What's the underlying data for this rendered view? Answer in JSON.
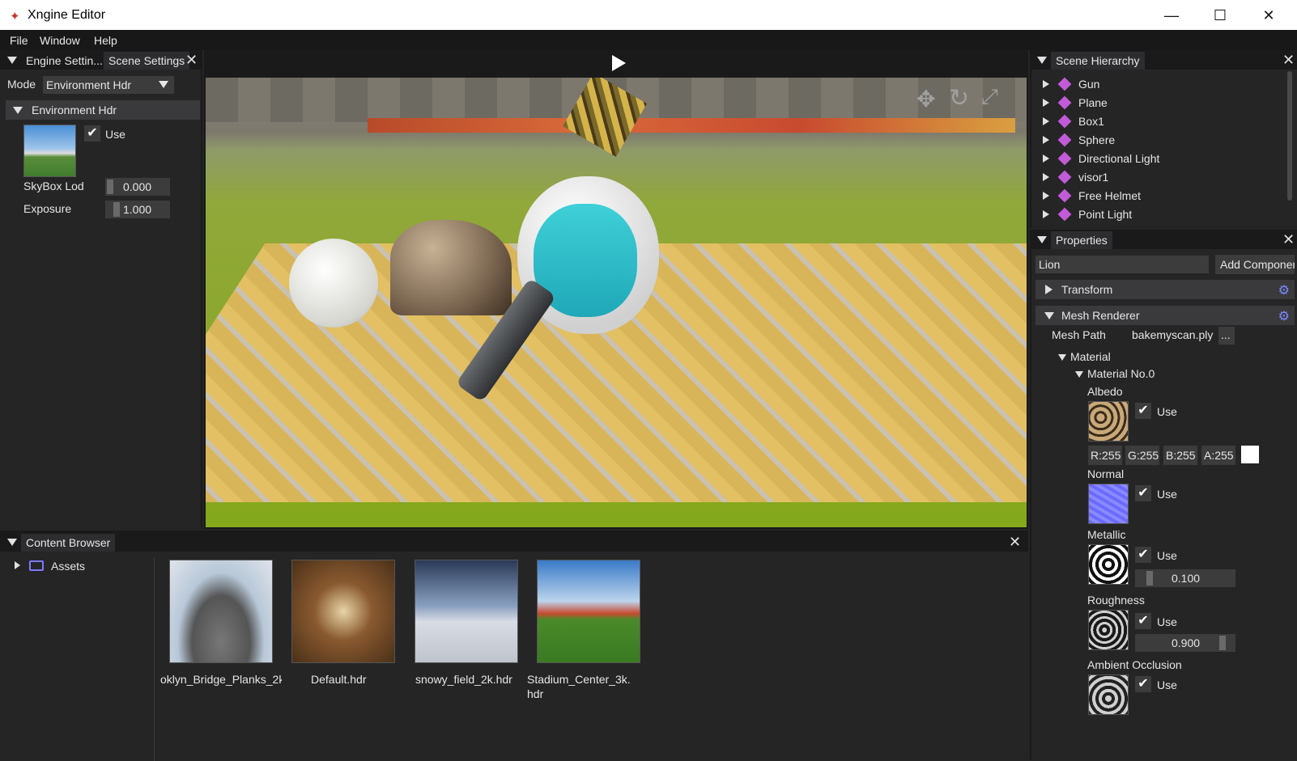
{
  "window": {
    "title": "Xngine Editor",
    "min_icon": "minimize-icon",
    "max_icon": "maximize-icon",
    "close_icon": "close-icon"
  },
  "menu": [
    "File",
    "Window",
    "Help"
  ],
  "engine_panel": {
    "tabs": [
      "Engine Settin...",
      "Scene Settings"
    ],
    "mode_label": "Mode",
    "mode_value": "Environment Hdr",
    "section": "Environment Hdr",
    "use_label": "Use",
    "skybox_label": "SkyBox Lod",
    "skybox_value": "0.000",
    "exposure_label": "Exposure",
    "exposure_value": "1.000"
  },
  "viewport": {
    "play_icon": "play-icon",
    "gizmo_icons": [
      "move-icon",
      "rotate-icon",
      "scale-icon"
    ]
  },
  "hierarchy": {
    "title": "Scene Hierarchy",
    "items": [
      "Gun",
      "Plane",
      "Box1",
      "Sphere",
      "Directional Light",
      "visor1",
      "Free Helmet",
      "Point Light"
    ]
  },
  "properties": {
    "title": "Properties",
    "name_value": "Lion",
    "add_component": "Add Componer",
    "transform": "Transform",
    "mesh_renderer": "Mesh Renderer",
    "mesh_path_label": "Mesh Path",
    "mesh_path_value": "bakemyscan.ply",
    "browse": "...",
    "material": "Material",
    "material_no": "Material No.0",
    "albedo": "Albedo",
    "use": "Use",
    "rgba": [
      "R:255",
      "G:255",
      "B:255",
      "A:255"
    ],
    "normal": "Normal",
    "metallic": "Metallic",
    "metallic_value": "0.100",
    "roughness": "Roughness",
    "roughness_value": "0.900",
    "ao": "Ambient Occlusion"
  },
  "content_browser": {
    "title": "Content Browser",
    "tree_root": "Assets",
    "files": [
      "oklyn_Bridge_Planks_2k",
      "Default.hdr",
      "snowy_field_2k.hdr",
      "Stadium_Center_3k.",
      "hdr"
    ]
  },
  "colors": {
    "accent_cube": "#c25bd8",
    "folder": "#7a7aff"
  }
}
